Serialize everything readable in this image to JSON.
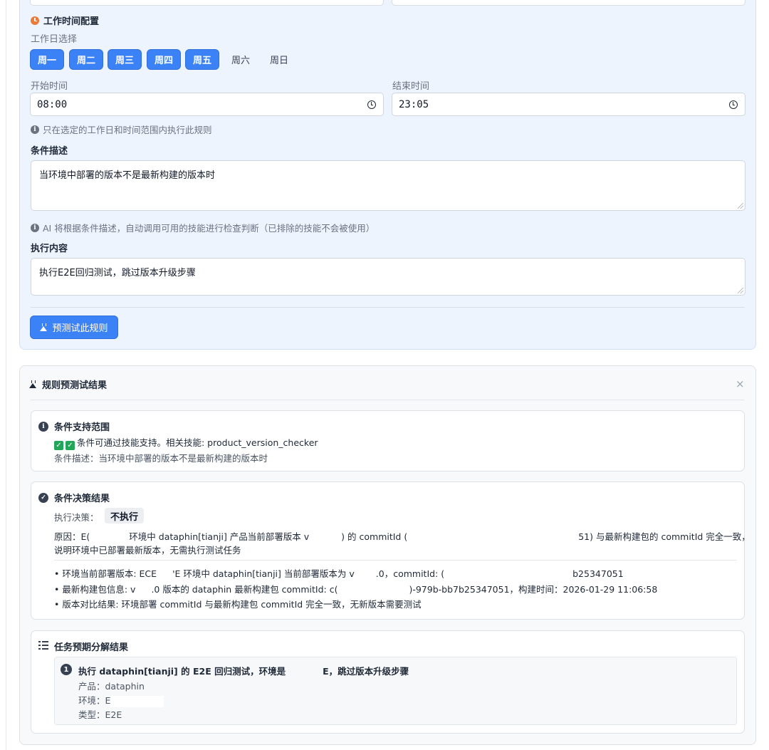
{
  "work_time": {
    "section_title": "工作时间配置",
    "weekday_label": "工作日选择",
    "days": [
      {
        "label": "周一",
        "selected": true
      },
      {
        "label": "周二",
        "selected": true
      },
      {
        "label": "周三",
        "selected": true
      },
      {
        "label": "周四",
        "selected": true
      },
      {
        "label": "周五",
        "selected": true
      },
      {
        "label": "周六",
        "selected": false
      },
      {
        "label": "周日",
        "selected": false
      }
    ],
    "start_label": "开始时间",
    "start_value": "08:00",
    "end_label": "结束时间",
    "end_value": "23:05",
    "hint": "只在选定的工作日和时间范围内执行此规则"
  },
  "condition": {
    "label": "条件描述",
    "value": "当环境中部署的版本不是最新构建的版本时",
    "hint": "AI 将根据条件描述，自动调用可用的技能进行检查判断（已排除的技能不会被使用）"
  },
  "action": {
    "label": "执行内容",
    "value": "执行E2E回归测试，跳过版本升级步骤"
  },
  "test_button": "预测试此规则",
  "results": {
    "title": "规则预测试结果",
    "close": "×",
    "support": {
      "title": "条件支持范围",
      "line1": "条件可通过技能支持。相关技能: product_version_checker",
      "line2": "条件描述：当环境中部署的版本不是最新构建的版本时"
    },
    "decision": {
      "title": "条件决策结果",
      "decision_label": "执行决策：",
      "decision_value": "不执行",
      "reason_a": "原因：E(",
      "reason_b": "环境中 dataphin[tianji] 产品当前部署版本 v",
      "reason_c": ") 的 commitId (",
      "reason_d": "51) 与最新构建包的 commitId 完全一致，",
      "reason_line2": "说明环境中已部署最新版本，无需执行测试任务",
      "b1_a": "• 环境当前部署版本: ECE",
      "b1_b": "'E 环境中 dataphin[tianji] 当前部署版本为 v",
      "b1_c": ".0，commitId: (",
      "b1_d": "b25347051",
      "b2_a": "• 最新构建包信息: v",
      "b2_b": ".0 版本的 dataphin 最新构建包 commitId: c(",
      "b2_c": ")-979b-bb7b25347051，构建时间：2026-01-29 11:06:58",
      "b3": "• 版本对比结果: 环境部署 commitId 与最新构建包 commitId 完全一致，无新版本需要测试"
    },
    "tasks": {
      "title": "任务预期分解结果",
      "item_number": "1",
      "item_title_a": "执行 dataphin[tianji] 的 E2E 回归测试，环境是",
      "item_title_b": "E，跳过版本升级步骤",
      "product": "产品：dataphin",
      "env": "环境：E",
      "type": "类型：E2E"
    }
  }
}
